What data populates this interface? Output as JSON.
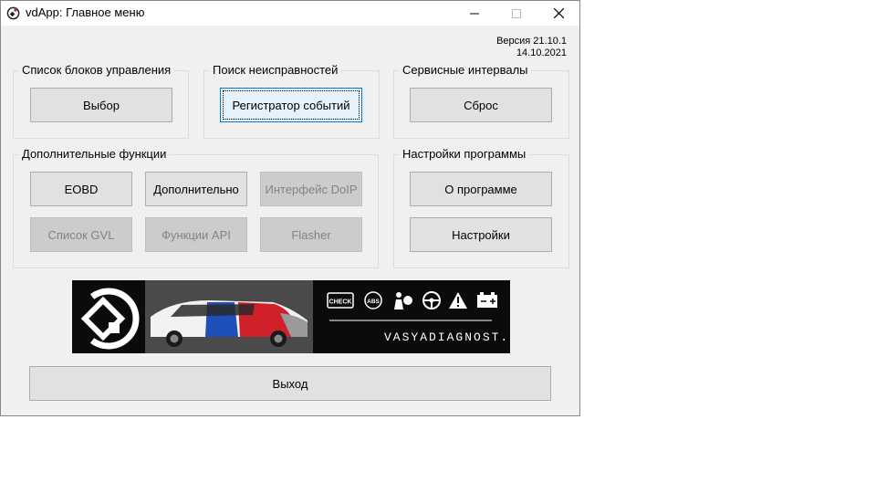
{
  "window": {
    "title": "vdApp:  Главное меню",
    "icon": "vd-logo-icon",
    "controls": {
      "minimize": "minimize-icon",
      "maximize": "maximize-icon",
      "close": "close-icon"
    }
  },
  "version": {
    "line1": "Версия 21.10.1",
    "line2": "14.10.2021"
  },
  "groups": {
    "blocks": {
      "label": "Список блоков управления",
      "button": "Выбор"
    },
    "faults": {
      "label": "Поиск неисправностей",
      "button": "Регистратор событий"
    },
    "service": {
      "label": "Сервисные интервалы",
      "button": "Сброс"
    },
    "extra": {
      "label": "Дополнительные функции",
      "buttons": [
        "EOBD",
        "Дополнительно",
        "Интерфейс DoIP",
        "Список GVL",
        "Функции API",
        "Flasher"
      ]
    },
    "settings": {
      "label": "Настройки программы",
      "about": "О программе",
      "settings": "Настройки"
    }
  },
  "banner": {
    "site": "VASYADIAGNOST.COM",
    "badges": {
      "check": "CHECK",
      "abs": "ABS"
    },
    "icons": [
      "check-engine-icon",
      "abs-icon",
      "airbag-icon",
      "steering-icon",
      "warning-icon",
      "battery-icon"
    ],
    "colors": {
      "background": "#0b0b0b",
      "blue": "#1f4fb8",
      "red": "#d0202a",
      "white": "#f2f2f2"
    }
  },
  "exit": "Выход"
}
